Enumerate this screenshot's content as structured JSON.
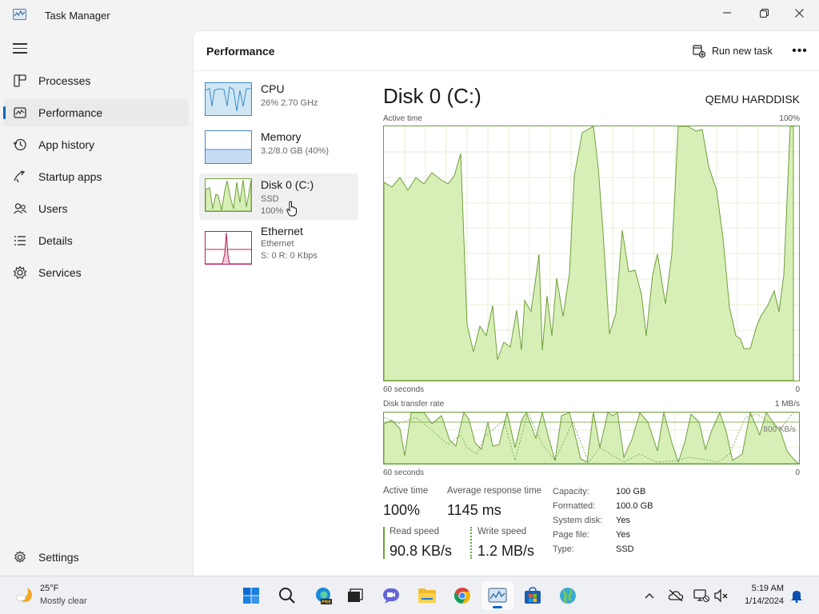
{
  "window": {
    "title": "Task Manager"
  },
  "nav": {
    "items": [
      {
        "label": "Processes",
        "icon": "processes-icon"
      },
      {
        "label": "Performance",
        "icon": "performance-icon",
        "active": true
      },
      {
        "label": "App history",
        "icon": "app-history-icon"
      },
      {
        "label": "Startup apps",
        "icon": "startup-apps-icon"
      },
      {
        "label": "Users",
        "icon": "users-icon"
      },
      {
        "label": "Details",
        "icon": "details-icon"
      },
      {
        "label": "Services",
        "icon": "services-icon"
      }
    ],
    "settings_label": "Settings"
  },
  "header": {
    "title": "Performance",
    "run_new_task": "Run new task",
    "more": "•••"
  },
  "devices": [
    {
      "name": "CPU",
      "sub1": "26%  2.70 GHz",
      "sub2": ""
    },
    {
      "name": "Memory",
      "sub1": "3.2/8.0 GB (40%)",
      "sub2": ""
    },
    {
      "name": "Disk 0 (C:)",
      "sub1": "SSD",
      "sub2": "100%",
      "active": true
    },
    {
      "name": "Ethernet",
      "sub1": "Ethernet",
      "sub2": "S: 0  R: 0 Kbps"
    }
  ],
  "disk": {
    "title": "Disk 0 (C:)",
    "model": "QEMU HARDDISK",
    "active_time_label": "Active time",
    "active_time_max": "100%",
    "time_left": "60 seconds",
    "time_right": "0",
    "transfer_label": "Disk transfer rate",
    "transfer_max": "1 MB/s",
    "transfer_mid": "800 KB/s",
    "stats": {
      "active_time_label": "Active time",
      "active_time": "100%",
      "avg_response_label": "Average response time",
      "avg_response": "1145 ms",
      "read_speed_label": "Read speed",
      "read_speed": "90.8 KB/s",
      "write_speed_label": "Write speed",
      "write_speed": "1.2 MB/s"
    },
    "props": [
      {
        "k": "Capacity:",
        "v": "100 GB"
      },
      {
        "k": "Formatted:",
        "v": "100.0 GB"
      },
      {
        "k": "System disk:",
        "v": "Yes"
      },
      {
        "k": "Page file:",
        "v": "Yes"
      },
      {
        "k": "Type:",
        "v": "SSD"
      }
    ]
  },
  "taskbar": {
    "weather_temp": "25°F",
    "weather_desc": "Mostly clear",
    "clock_time": "5:19 AM",
    "clock_date": "1/14/2024"
  },
  "colors": {
    "disk_line": "#6f9e3a",
    "disk_fill": "#d7efb7",
    "cpu_line": "#3a8cc4",
    "cpu_fill": "#cfe6f5",
    "mem_fill": "#c5dcf2",
    "eth_line": "#b4235a",
    "accent": "#0067c0"
  }
}
